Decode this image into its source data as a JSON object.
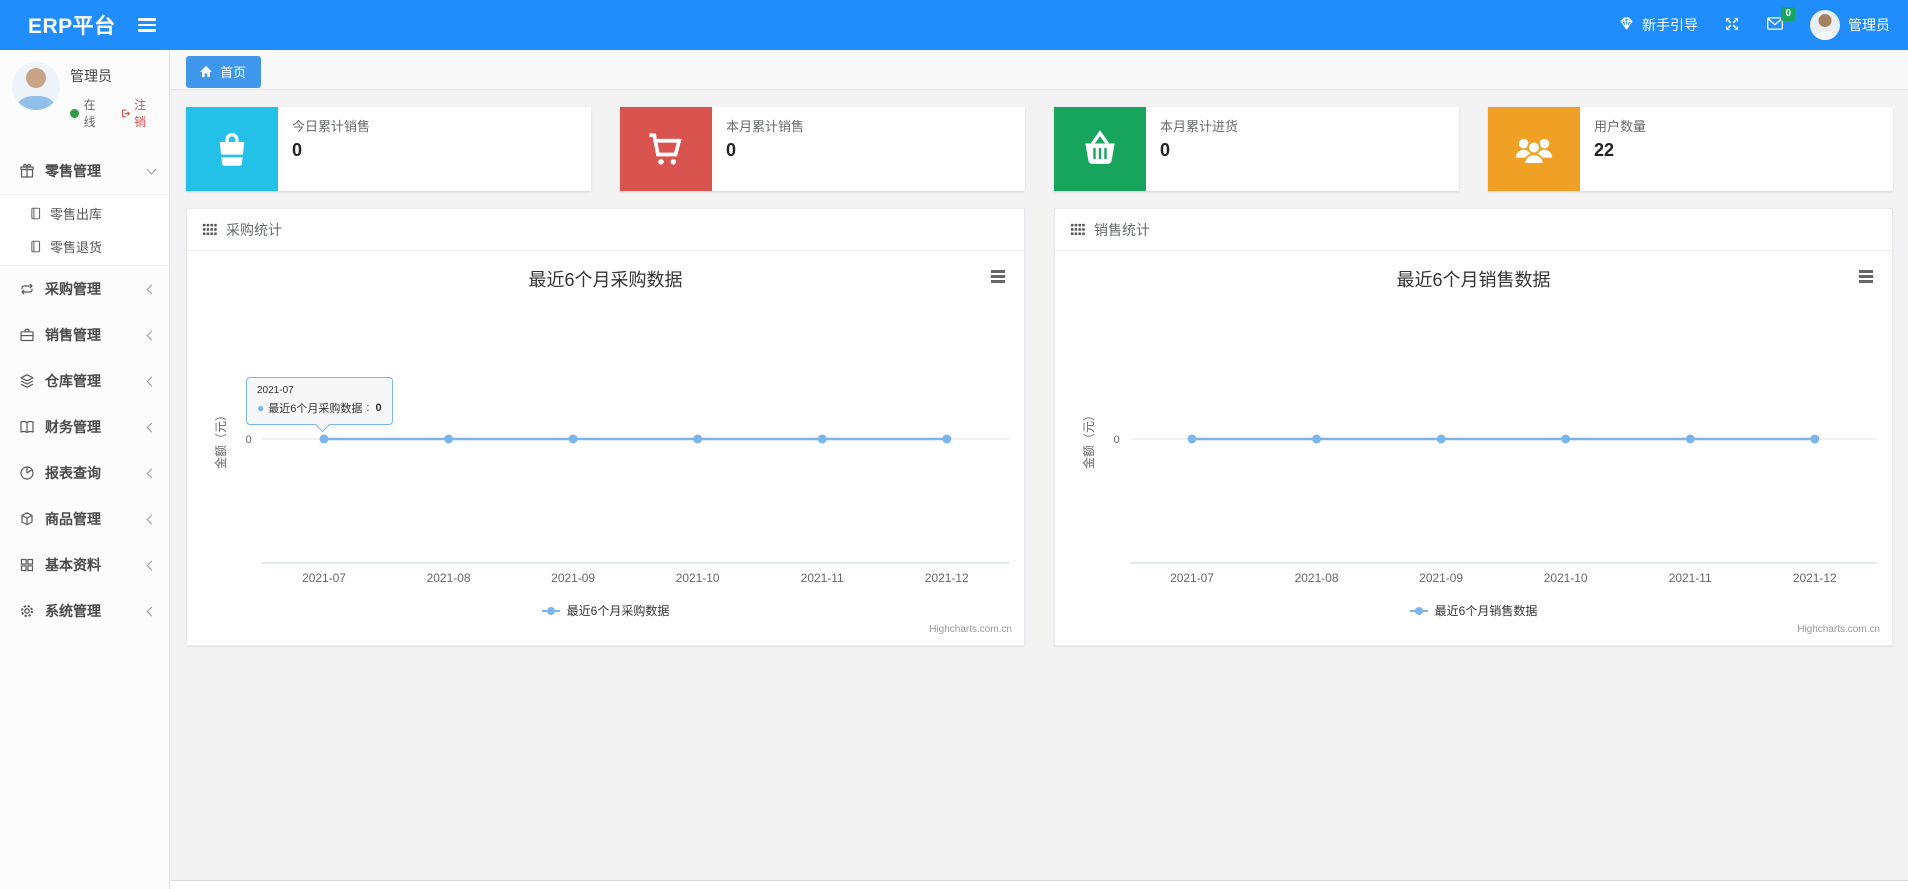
{
  "colors": {
    "navbar_bg": "#1f8dfb",
    "tab_bg": "#3e97ea",
    "badge_green": "#18a45d",
    "status_green": "#2f9e44",
    "logout_red": "#d9534f",
    "chart_line": "#7cb5ec",
    "card_cyan": "#23c0e8",
    "card_red": "#d9534f",
    "card_green": "#17a45d",
    "card_orange": "#f0a125"
  },
  "navbar": {
    "brand": "ERP平台",
    "guide_label": "新手引导",
    "message_count": "0",
    "username": "管理员"
  },
  "sidebar": {
    "user": {
      "name": "管理员",
      "status": "在线",
      "logout": "注销"
    },
    "items": [
      {
        "label": "零售管理",
        "icon": "gift-icon",
        "state": "expanded",
        "children": [
          {
            "label": "零售出库",
            "icon": "file-icon"
          },
          {
            "label": "零售退货",
            "icon": "file-icon"
          }
        ]
      },
      {
        "label": "采购管理",
        "icon": "repeat-icon"
      },
      {
        "label": "销售管理",
        "icon": "briefcase-icon"
      },
      {
        "label": "仓库管理",
        "icon": "layers-icon"
      },
      {
        "label": "财务管理",
        "icon": "book-icon"
      },
      {
        "label": "报表查询",
        "icon": "pie-chart-icon"
      },
      {
        "label": "商品管理",
        "icon": "box-icon"
      },
      {
        "label": "基本资料",
        "icon": "grid-icon"
      },
      {
        "label": "系统管理",
        "icon": "gear-icon"
      }
    ]
  },
  "breadcrumb": {
    "home": "首页"
  },
  "cards": [
    {
      "title": "今日累计销售",
      "value": "0",
      "color": "#23c0e8",
      "icon": "shopping-bag-icon"
    },
    {
      "title": "本月累计销售",
      "value": "0",
      "color": "#d9534f",
      "icon": "shopping-cart-icon"
    },
    {
      "title": "本月累计进货",
      "value": "0",
      "color": "#17a45d",
      "icon": "shopping-basket-icon"
    },
    {
      "title": "用户数量",
      "value": "22",
      "color": "#f0a125",
      "icon": "users-icon"
    }
  ],
  "panels": [
    {
      "title": "采购统计"
    },
    {
      "title": "销售统计"
    }
  ],
  "chart_data": [
    {
      "type": "line",
      "title": "最近6个月采购数据",
      "categories": [
        "2021-07",
        "2021-08",
        "2021-09",
        "2021-10",
        "2021-11",
        "2021-12"
      ],
      "series": [
        {
          "name": "最近6个月采购数据",
          "color": "#7cb5ec",
          "values": [
            0,
            0,
            0,
            0,
            0,
            0
          ]
        }
      ],
      "ylabel": "金额（元）",
      "ytick": "0",
      "ylim": [
        -1,
        1
      ],
      "grid": "single-zero-gridline",
      "legend_position": "bottom-center",
      "credits": "Highcharts.com.cn",
      "tooltip": {
        "header": "2021-07",
        "series_name": "最近6个月采购数据",
        "separator": ":",
        "value": "0"
      }
    },
    {
      "type": "line",
      "title": "最近6个月销售数据",
      "categories": [
        "2021-07",
        "2021-08",
        "2021-09",
        "2021-10",
        "2021-11",
        "2021-12"
      ],
      "series": [
        {
          "name": "最近6个月销售数据",
          "color": "#7cb5ec",
          "values": [
            0,
            0,
            0,
            0,
            0,
            0
          ]
        }
      ],
      "ylabel": "金额（元）",
      "ytick": "0",
      "ylim": [
        -1,
        1
      ],
      "grid": "single-zero-gridline",
      "legend_position": "bottom-center",
      "credits": "Highcharts.com.cn"
    }
  ]
}
